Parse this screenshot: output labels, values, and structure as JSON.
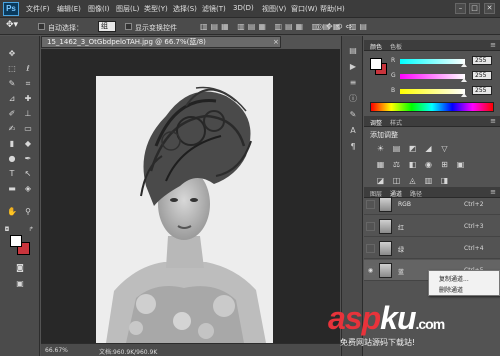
{
  "app": {
    "logo": "Ps"
  },
  "menubar": {
    "items": [
      "文件(F)",
      "编辑(E)",
      "图像(I)",
      "图层(L)",
      "类型(Y)",
      "选择(S)",
      "滤镜(T)",
      "3D(D)",
      "视图(V)",
      "窗口(W)",
      "帮助(H)"
    ],
    "window_controls": [
      "–",
      "□",
      "✕"
    ]
  },
  "options": {
    "auto_select": "自动选择：",
    "auto_select_value": "组",
    "show_transform": "显示变换控件"
  },
  "document": {
    "tab_title": "15_1462_3_OtGbdpeloTAH.jpg @ 66.7%(蓝/8)",
    "close": "×",
    "zoom": "66.67%",
    "doc_info": "文档:960.9K/960.9K"
  },
  "colors": {
    "foreground": "#ffffff",
    "background": "#c8343c"
  },
  "color_panel": {
    "tabs": [
      "颜色",
      "色板"
    ],
    "sliders": [
      {
        "label": "R",
        "value": "255",
        "gradient": "linear-gradient(to right,#00ffff,#ffffff)"
      },
      {
        "label": "G",
        "value": "255",
        "gradient": "linear-gradient(to right,#ff00ff,#ffffff)"
      },
      {
        "label": "B",
        "value": "255",
        "gradient": "linear-gradient(to right,#ffff00,#ffffff)"
      }
    ]
  },
  "adjust_panel": {
    "tabs": [
      "调整",
      "样式"
    ],
    "title": "添加调整",
    "icons_row1": [
      "☀",
      "▤",
      "◩",
      "◢",
      "▽"
    ],
    "icons_row2": [
      "▦",
      "⚖",
      "◧",
      "◉",
      "⊞",
      "▣"
    ],
    "icons_row3": [
      "◪",
      "◫",
      "◬",
      "▥",
      "◨"
    ]
  },
  "layers_panel": {
    "tabs": [
      "图层",
      "通道",
      "路径"
    ],
    "rows": [
      {
        "name": "RGB",
        "key": "Ctrl+2"
      },
      {
        "name": "红",
        "key": "Ctrl+3"
      },
      {
        "name": "绿",
        "key": "Ctrl+4"
      },
      {
        "name": "蓝",
        "key": "Ctrl+5"
      }
    ]
  },
  "context_menu": {
    "items": [
      "复制通道...",
      "删除通道"
    ]
  },
  "watermark": {
    "letters": [
      "a",
      "s",
      "p",
      "k",
      "u"
    ],
    "colors": [
      "#e8333b",
      "#e8333b",
      "#e8333b",
      "#ffffff",
      "#ffffff"
    ],
    "tld": ".com",
    "subtitle": "免费网站源码下载站!"
  }
}
